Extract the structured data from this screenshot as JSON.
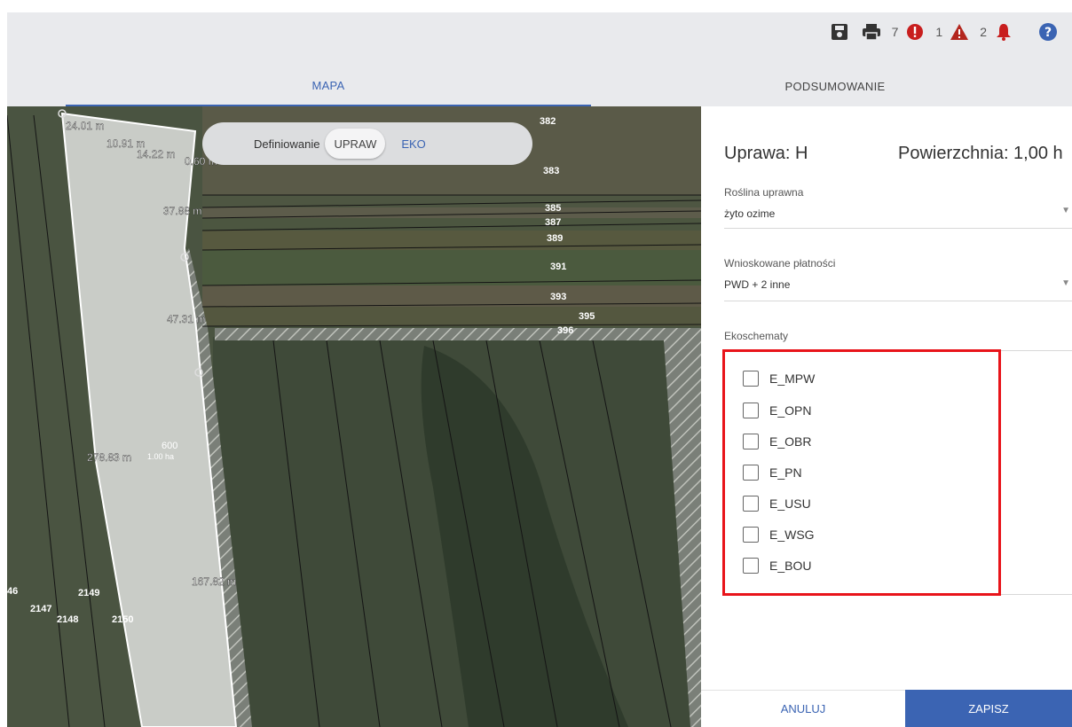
{
  "toolbar": {
    "errors_count": "7",
    "warnings_count": "1",
    "notifications_count": "2",
    "error_color": "#c81e1e",
    "warning_color": "#b3261e",
    "icons": [
      "save-icon",
      "print-icon",
      "error-icon",
      "warning-icon",
      "bell-icon",
      "help-icon"
    ]
  },
  "tabs": [
    {
      "label": "MAPA",
      "active": true
    },
    {
      "label": "PODSUMOWANIE",
      "active": false
    }
  ],
  "map": {
    "toggle_label": "Definiowanie",
    "toggle_options": [
      "UPRAW",
      "EKO"
    ],
    "parcel_numbers": [
      "382",
      "383",
      "385",
      "387",
      "389",
      "391",
      "393",
      "395",
      "396",
      "2147",
      "2148",
      "2149",
      "2150",
      "46"
    ],
    "measurements": [
      "24.01 m",
      "10.91 m",
      "14.22 m",
      "0.60 m",
      "37.88 m",
      "47.31 m",
      "278.83 m",
      "167.82 m"
    ],
    "field_label": "600",
    "field_area": "1.00 ha"
  },
  "panel": {
    "crop_title": "Uprawa: H",
    "area_title": "Powierzchnia: 1,00 h",
    "crop_label": "Roślina uprawna",
    "crop_value": "żyto ozime",
    "payments_label": "Wnioskowane płatności",
    "payments_value": "PWD + 2 inne",
    "ecoschemes_label": "Ekoschematy",
    "ecoschemes": [
      "E_MPW",
      "E_OPN",
      "E_OBR",
      "E_PN",
      "E_USU",
      "E_WSG",
      "E_BOU"
    ],
    "cancel_label": "ANULUJ",
    "save_label": "ZAPISZ",
    "accent_color": "#3b64b3",
    "highlight_color": "#e8141a"
  }
}
